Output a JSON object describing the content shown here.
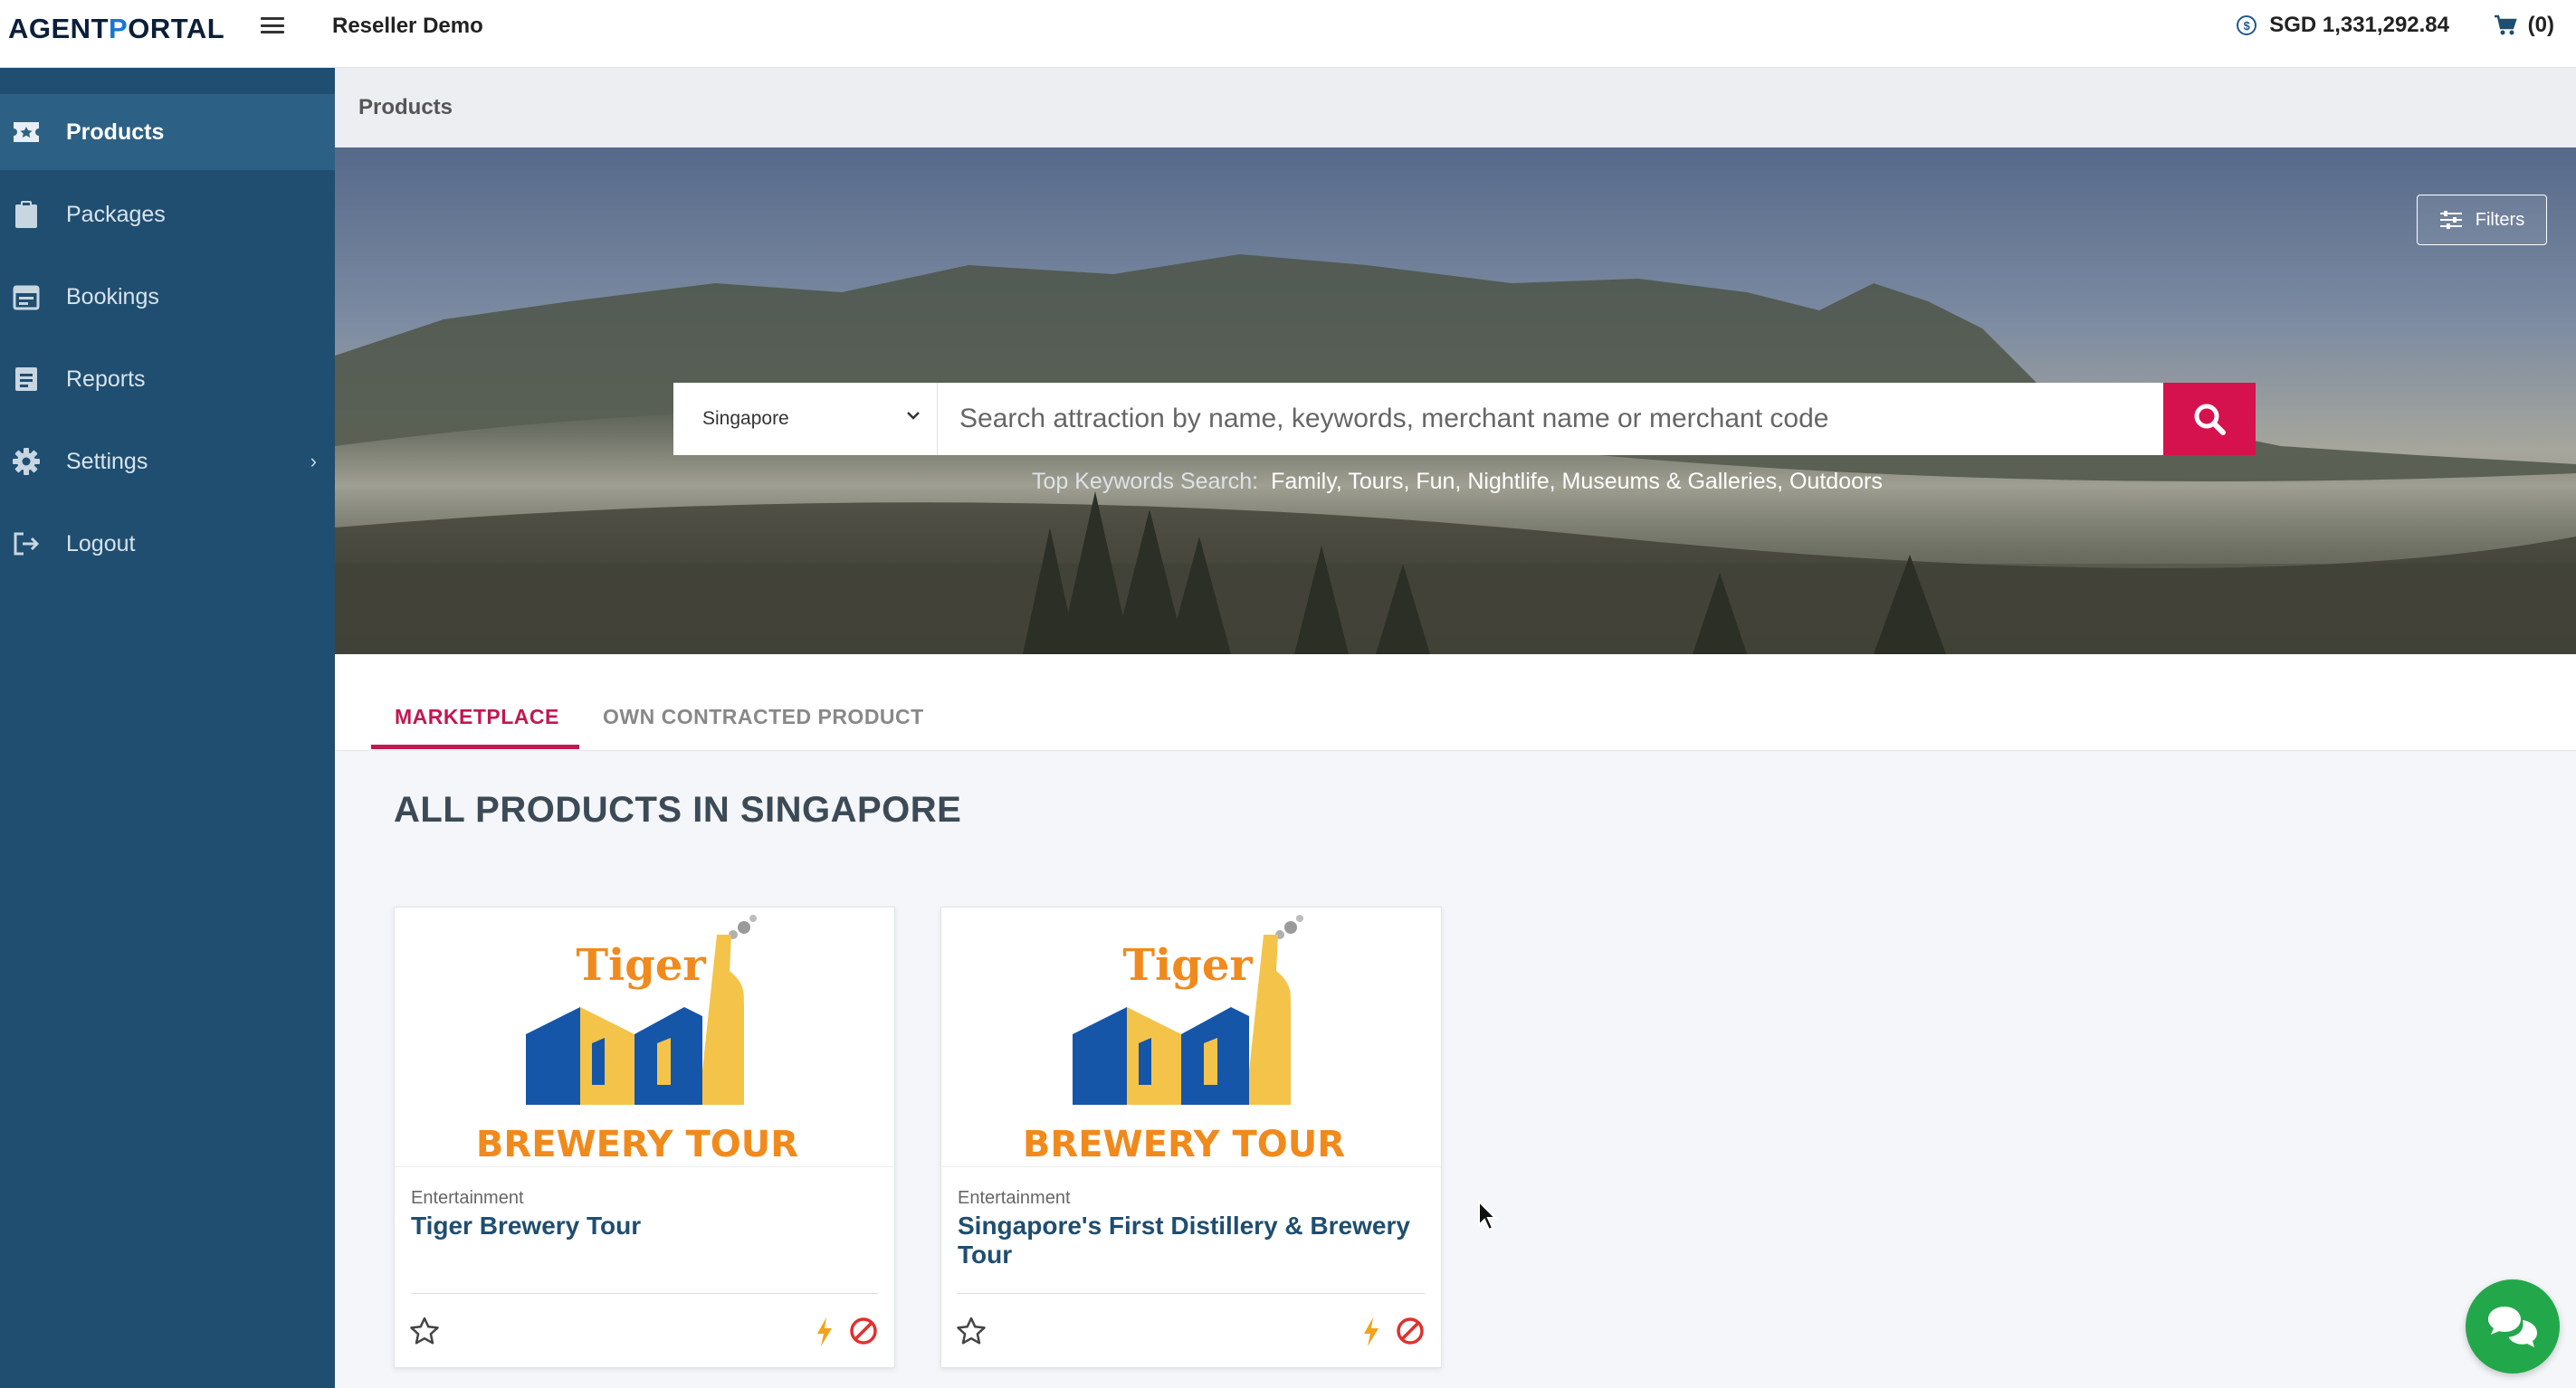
{
  "header": {
    "logo_part1": "A",
    "logo_part2": "GENT",
    "logo_part3": "P",
    "logo_part4": "ORTAL",
    "account_name": "Reseller Demo",
    "balance": "SGD 1,331,292.84",
    "cart": "(0)"
  },
  "sidebar": {
    "items": [
      {
        "label": "Products",
        "icon": "ticket-icon",
        "active": true
      },
      {
        "label": "Packages",
        "icon": "clipboard-icon"
      },
      {
        "label": "Bookings",
        "icon": "calendar-icon"
      },
      {
        "label": "Reports",
        "icon": "report-icon"
      },
      {
        "label": "Settings",
        "icon": "gear-icon"
      },
      {
        "label": "Logout",
        "icon": "logout-icon"
      }
    ]
  },
  "breadcrumb": "Products",
  "hero": {
    "filters_label": "Filters",
    "country": "Singapore",
    "search_placeholder": "Search attraction by name, keywords, merchant name or merchant code",
    "keywords_label": "Top Keywords Search:",
    "keywords": "Family, Tours, Fun, Nightlife, Museums & Galleries, Outdoors"
  },
  "tabs": [
    {
      "label": "MARKETPLACE",
      "active": true
    },
    {
      "label": "OWN CONTRACTED PRODUCT",
      "active": false
    }
  ],
  "section_title": "ALL PRODUCTS IN SINGAPORE",
  "products": [
    {
      "category": "Entertainment",
      "title": "Tiger Brewery Tour",
      "logo_brand": "Tiger",
      "logo_caption": "BREWERY TOUR"
    },
    {
      "category": "Entertainment",
      "title": "Singapore's First Distillery & Brewery Tour",
      "logo_brand": "Tiger",
      "logo_caption": "BREWERY TOUR"
    }
  ],
  "colors": {
    "sidebar": "#1f4e70",
    "accent": "#c2184f",
    "search_button": "#d6124e",
    "chat": "#22a84a"
  }
}
